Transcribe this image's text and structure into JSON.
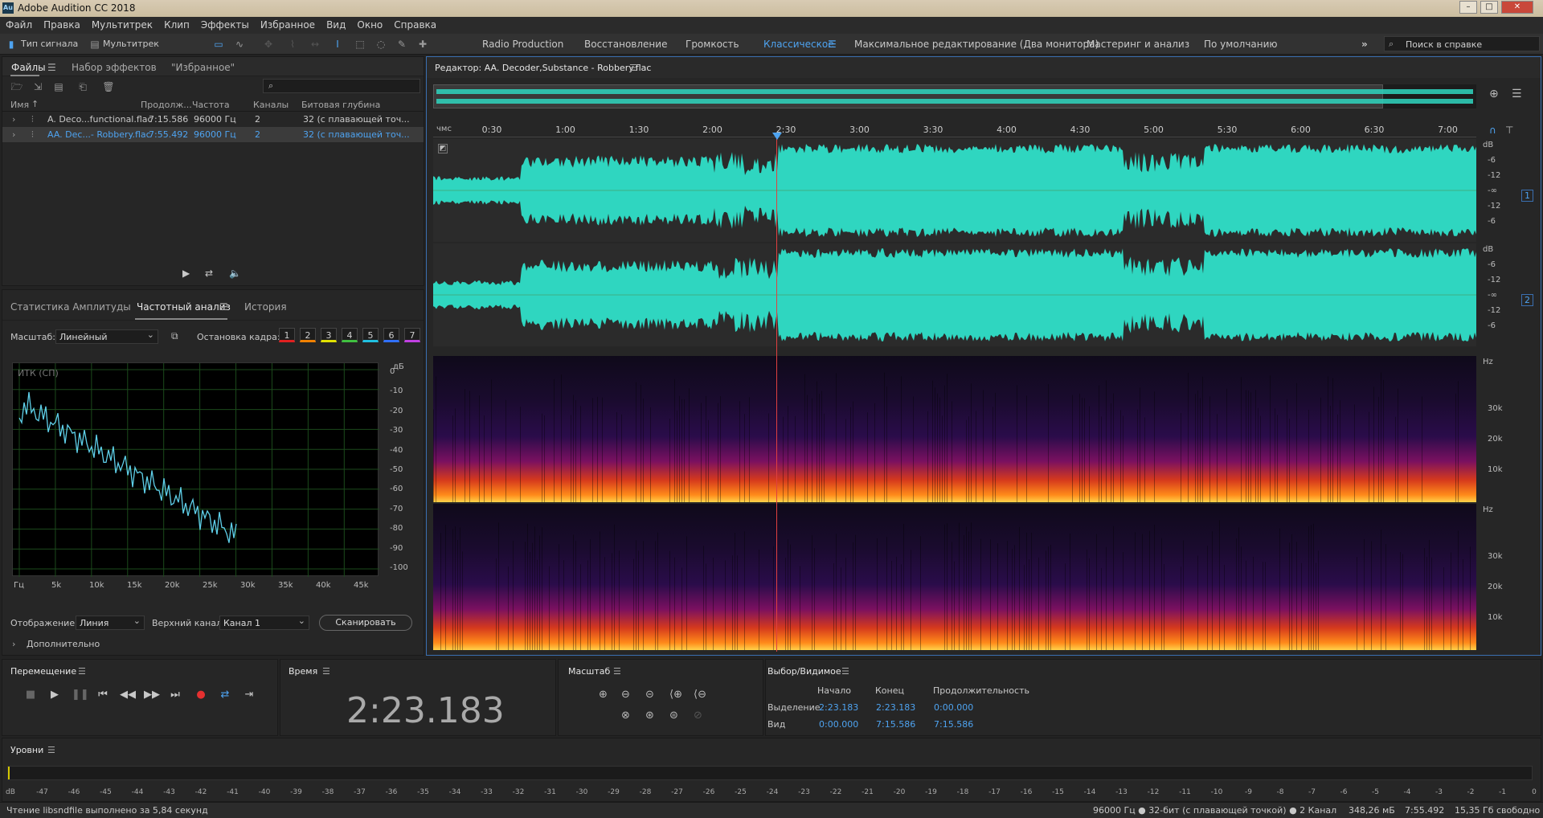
{
  "app": {
    "title": "Adobe Audition CC 2018",
    "logo": "Au"
  },
  "menu": [
    "Файл",
    "Правка",
    "Мультитрек",
    "Клип",
    "Эффекты",
    "Избранное",
    "Вид",
    "Окно",
    "Справка"
  ],
  "toolbar": {
    "waveform_label": "Тип сигнала",
    "multitrack_label": "Мультитрек",
    "workspaces": [
      "Radio Production",
      "Восстановление",
      "Громкость",
      "Классическое",
      "Максимальное редактирование (Два монитора)",
      "Мастеринг и анализ",
      "По умолчанию"
    ],
    "active_workspace": "Классическое",
    "search_placeholder": "Поиск в справке"
  },
  "files_panel": {
    "tabs": [
      "Файлы",
      "Набор эффектов",
      "\"Избранное\""
    ],
    "columns": [
      "Имя",
      "Продолж...",
      "Частота",
      "Каналы",
      "Битовая глубина"
    ],
    "rows": [
      {
        "name": "A. Deco...functional.flac",
        "duration": "7:15.586",
        "rate": "96000 Гц",
        "channels": "2",
        "depth": "32 (с плавающей точ..."
      },
      {
        "name": "AA. Dec...- Robbery.flac",
        "duration": "7:55.492",
        "rate": "96000 Гц",
        "channels": "2",
        "depth": "32 (с плавающей точ..."
      }
    ]
  },
  "freq_panel": {
    "tabs": [
      "Статистика Амплитуды",
      "Частотный анализ",
      "История"
    ],
    "scale_label": "Масштаб:",
    "scale_value": "Линейный",
    "freeze_label": "Остановка кадра:",
    "freeze_buttons": [
      "1",
      "2",
      "3",
      "4",
      "5",
      "6",
      "7"
    ],
    "freeze_colors": [
      "#e02020",
      "#f08000",
      "#e0e000",
      "#40c040",
      "#20c0e0",
      "#3070ff",
      "#c040e0"
    ],
    "graph_title": "ИТК (СП)",
    "y_labels": [
      "0",
      "-10",
      "-20",
      "-30",
      "-40",
      "-50",
      "-60",
      "-70",
      "-80",
      "-90",
      "-100"
    ],
    "y_unit": "дБ",
    "x_labels": [
      "Гц",
      "5k",
      "10k",
      "15k",
      "20k",
      "25k",
      "30k",
      "35k",
      "40k",
      "45k"
    ],
    "display_label": "Отображение:",
    "display_value": "Линия",
    "channel_label": "Верхний канал:",
    "channel_value": "Канал 1",
    "scan_button": "Сканировать",
    "advanced_label": "Дополнительно"
  },
  "editor": {
    "title": "Редактор: AA. Decoder,Substance - Robbery.flac",
    "ruler_unit": "чмс",
    "ruler_labels": [
      "0:30",
      "1:00",
      "1:30",
      "2:00",
      "2:30",
      "3:00",
      "3:30",
      "4:00",
      "4:30",
      "5:00",
      "5:30",
      "6:00",
      "6:30",
      "7:00"
    ],
    "db_labels": [
      "dB",
      "-6",
      "-12",
      "-∞",
      "-12",
      "-6"
    ],
    "channels": [
      "1",
      "2"
    ],
    "hz_label": "Hz",
    "hz_labels": [
      "30k",
      "20k",
      "10k"
    ],
    "playhead_time": "2:23.183",
    "wave_color": "#2fd6c0"
  },
  "transport": {
    "title": "Перемещение",
    "buttons": [
      "stop",
      "play",
      "pause",
      "to-start",
      "rewind",
      "forward",
      "to-end",
      "record",
      "loop",
      "skip"
    ]
  },
  "time_panel": {
    "title": "Время",
    "value": "2:23.183"
  },
  "zoom_panel": {
    "title": "Масштаб"
  },
  "selection_panel": {
    "title": "Выбор/Видимое",
    "cols": [
      "Начало",
      "Конец",
      "Продолжительность"
    ],
    "rows": [
      {
        "label": "Выделение",
        "start": "2:23.183",
        "end": "2:23.183",
        "dur": "0:00.000"
      },
      {
        "label": "Вид",
        "start": "0:00.000",
        "end": "7:15.586",
        "dur": "7:15.586"
      }
    ]
  },
  "levels": {
    "title": "Уровни",
    "labels": [
      "dB",
      "-47",
      "-46",
      "-45",
      "-44",
      "-43",
      "-42",
      "-41",
      "-40",
      "-39",
      "-38",
      "-37",
      "-36",
      "-35",
      "-34",
      "-33",
      "-32",
      "-31",
      "-30",
      "-29",
      "-28",
      "-27",
      "-26",
      "-25",
      "-24",
      "-23",
      "-22",
      "-21",
      "-20",
      "-19",
      "-18",
      "-17",
      "-16",
      "-15",
      "-14",
      "-13",
      "-12",
      "-11",
      "-10",
      "-9",
      "-8",
      "-7",
      "-6",
      "-5",
      "-4",
      "-3",
      "-2",
      "-1",
      "0"
    ]
  },
  "status": {
    "left": "Чтение libsndfile выполнено за 5,84 секунд",
    "format": "96000 Гц ● 32-бит (с плавающей точкой) ● 2 Канал",
    "size": "348,26 мБ",
    "duration": "7:55.492",
    "free": "15,35 Гб свободно"
  }
}
